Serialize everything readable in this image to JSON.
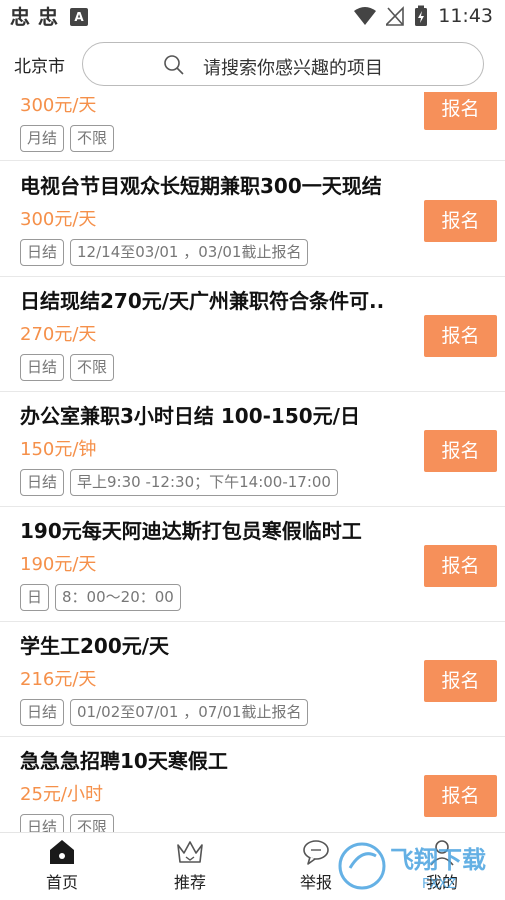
{
  "status_bar": {
    "app_icons": [
      "忠",
      "忠"
    ],
    "a_icon": "A",
    "time": "11:43"
  },
  "header": {
    "city": "北京市",
    "search_placeholder": "请搜索你感兴趣的项目"
  },
  "jobs": [
    {
      "title": "",
      "pay": "300元/天",
      "tags": [
        "月结",
        "不限"
      ],
      "button": "报名"
    },
    {
      "title": "电视台节目观众长短期兼职300一天现结",
      "pay": "300元/天",
      "tags": [
        "日结",
        "12/14至03/01 ，03/01截止报名"
      ],
      "button": "报名"
    },
    {
      "title": "日结现结270元/天广州兼职符合条件可..",
      "pay": "270元/天",
      "tags": [
        "日结",
        "不限"
      ],
      "button": "报名"
    },
    {
      "title": "办公室兼职3小时日结 100-150元/日",
      "pay": "150元/钟",
      "tags": [
        "日结",
        "早上9:30 -12:30；下午14:00-17:00"
      ],
      "button": "报名"
    },
    {
      "title": " 190元每天阿迪达斯打包员寒假临时工",
      "pay": "190元/天",
      "tags": [
        "日",
        "8：00～20：00"
      ],
      "button": "报名"
    },
    {
      "title": "学生工200元/天",
      "pay": "216元/天",
      "tags": [
        "日结",
        "01/02至07/01 ，07/01截止报名"
      ],
      "button": "报名"
    },
    {
      "title": "急急急招聘10天寒假工",
      "pay": "25元/小时",
      "tags": [
        "日结",
        "不限"
      ],
      "button": "报名"
    }
  ],
  "nav": [
    {
      "label": "首页",
      "icon": "home-icon",
      "active": true
    },
    {
      "label": "推荐",
      "icon": "crown-icon",
      "active": false
    },
    {
      "label": "举报",
      "icon": "chat-icon",
      "active": false
    },
    {
      "label": "我的",
      "icon": "person-icon",
      "active": false
    }
  ],
  "watermark": {
    "text": "飞翔下载",
    "sub": "FXXZ"
  },
  "colors": {
    "accent": "#f6905a",
    "pay_text": "#f5904a"
  }
}
